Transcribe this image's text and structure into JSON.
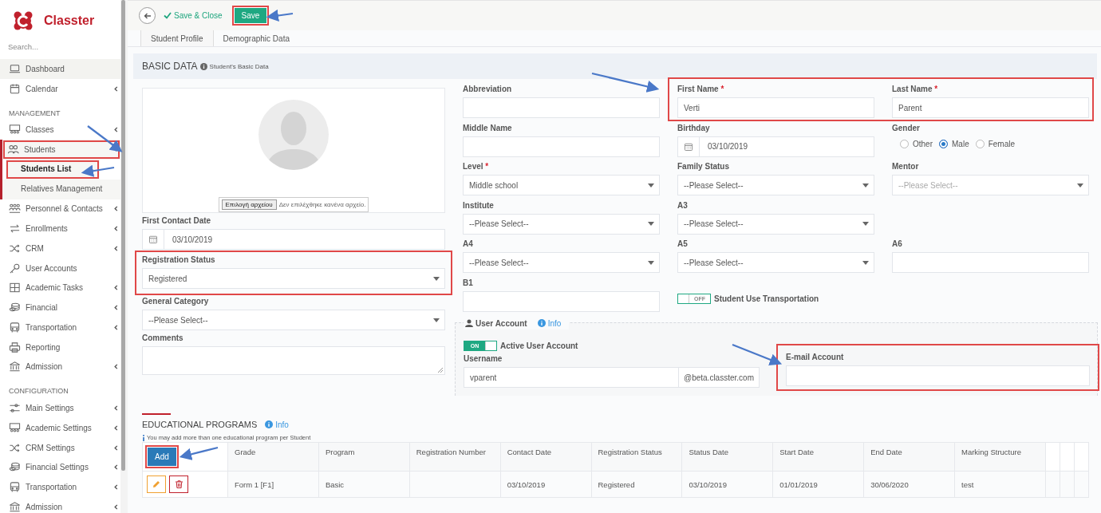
{
  "sidebar": {
    "logo": "Classter",
    "search": {
      "placeholder": "Search..."
    },
    "items": [
      {
        "kind": "link",
        "label": "Dashboard",
        "selected": true,
        "highlighted": false,
        "submenu": false
      },
      {
        "kind": "link",
        "label": "Calendar",
        "selected": false,
        "highlighted": false,
        "submenu": true,
        "expanded": false
      },
      {
        "kind": "header",
        "label": "MANAGEMENT"
      },
      {
        "kind": "link",
        "label": "Classes",
        "selected": false,
        "highlighted": false,
        "submenu": true,
        "expanded": false
      },
      {
        "kind": "link",
        "label": "Students",
        "selected": false,
        "highlighted": true,
        "submenu": true,
        "expanded": true,
        "children": [
          {
            "label": "Students List",
            "selected": true,
            "highlighted": true
          },
          {
            "label": "Relatives Management",
            "selected": false,
            "highlighted": false
          }
        ]
      },
      {
        "kind": "link",
        "label": "Personnel & Contacts",
        "selected": false,
        "highlighted": false,
        "submenu": true,
        "expanded": false
      },
      {
        "kind": "link",
        "label": "Enrollments",
        "selected": false,
        "highlighted": false,
        "submenu": true,
        "expanded": false
      },
      {
        "kind": "link",
        "label": "CRM",
        "selected": false,
        "highlighted": false,
        "submenu": true,
        "expanded": false
      },
      {
        "kind": "link",
        "label": "User Accounts",
        "selected": false,
        "highlighted": false,
        "submenu": false
      },
      {
        "kind": "link",
        "label": "Academic Tasks",
        "selected": false,
        "highlighted": false,
        "submenu": true,
        "expanded": false
      },
      {
        "kind": "link",
        "label": "Financial",
        "selected": false,
        "highlighted": false,
        "submenu": true,
        "expanded": false
      },
      {
        "kind": "link",
        "label": "Transportation",
        "selected": false,
        "highlighted": false,
        "submenu": true,
        "expanded": false
      },
      {
        "kind": "link",
        "label": "Reporting",
        "selected": false,
        "highlighted": false,
        "submenu": false
      },
      {
        "kind": "link",
        "label": "Admission",
        "selected": false,
        "highlighted": false,
        "submenu": true,
        "expanded": false
      },
      {
        "kind": "header",
        "label": "CONFIGURATION"
      },
      {
        "kind": "link",
        "label": "Main Settings",
        "selected": false,
        "highlighted": false,
        "submenu": true,
        "expanded": false
      },
      {
        "kind": "link",
        "label": "Academic Settings",
        "selected": false,
        "highlighted": false,
        "submenu": true,
        "expanded": false
      },
      {
        "kind": "link",
        "label": "CRM Settings",
        "selected": false,
        "highlighted": false,
        "submenu": true,
        "expanded": false
      },
      {
        "kind": "link",
        "label": "Financial Settings",
        "selected": false,
        "highlighted": false,
        "submenu": true,
        "expanded": false
      },
      {
        "kind": "link",
        "label": "Transportation",
        "selected": false,
        "highlighted": false,
        "submenu": true,
        "expanded": false
      },
      {
        "kind": "link",
        "label": "Admission",
        "selected": false,
        "highlighted": false,
        "submenu": true,
        "expanded": false
      }
    ]
  },
  "toolbar": {
    "save_close": "Save & Close",
    "save": {
      "label": "Save",
      "highlighted": true
    }
  },
  "tabs": [
    {
      "label": "Student Profile",
      "selected": true
    },
    {
      "label": "Demographic Data",
      "selected": false
    }
  ],
  "basic_data": {
    "title": "BASIC DATA",
    "subtitle": "Student's Basic Data"
  },
  "photo": {
    "file_button": "Επιλογή αρχείου",
    "file_status": "Δεν επιλέχθηκε κανένα αρχείο."
  },
  "left_fields": [
    {
      "kind": "date",
      "label": "First Contact Date",
      "value": "03/10/2019",
      "highlighted": false
    },
    {
      "kind": "select",
      "label": "Registration Status",
      "value": "Registered",
      "highlighted": true
    },
    {
      "kind": "select",
      "label": "General Category",
      "value": "--Please Select--",
      "highlighted": false
    },
    {
      "kind": "textarea",
      "label": "Comments",
      "highlighted": false
    }
  ],
  "grid_rows": [
    [
      {
        "kind": "text",
        "label": "Abbreviation"
      },
      {
        "kind": "group",
        "highlighted": true,
        "fields": [
          {
            "kind": "text",
            "label": "First Name",
            "required_mark": "*",
            "value": "Verti"
          },
          {
            "kind": "text",
            "label": "Last Name",
            "required_mark": "*",
            "value": "Parent"
          }
        ]
      }
    ],
    [
      {
        "kind": "text",
        "label": "Middle Name"
      },
      {
        "kind": "date",
        "label": "Birthday",
        "value": "03/10/2019"
      },
      {
        "kind": "radio",
        "label": "Gender",
        "options": [
          {
            "label": "Other",
            "selected": false
          },
          {
            "label": "Male",
            "selected": true
          },
          {
            "label": "Female",
            "selected": false
          }
        ]
      }
    ],
    [
      {
        "kind": "select",
        "label": "Level",
        "required_mark": "*",
        "value": "Middle school",
        "disabled": false
      },
      {
        "kind": "select",
        "label": "Family Status",
        "value": "--Please Select--",
        "disabled": false
      },
      {
        "kind": "select",
        "label": "Mentor",
        "value": "--Please Select--",
        "disabled": true
      }
    ],
    [
      {
        "kind": "select",
        "label": "Institute",
        "value": "--Please Select--",
        "disabled": false
      },
      {
        "kind": "select",
        "label": "A3",
        "value": "--Please Select--",
        "disabled": false
      },
      {
        "kind": "blank"
      }
    ],
    [
      {
        "kind": "select",
        "label": "A4",
        "value": "--Please Select--",
        "disabled": false
      },
      {
        "kind": "select",
        "label": "A5",
        "value": "--Please Select--",
        "disabled": false
      },
      {
        "kind": "text",
        "label": "A6"
      }
    ],
    [
      {
        "kind": "text",
        "label": "B1"
      },
      {
        "kind": "toggle",
        "label": "Student Use Transportation",
        "on": false,
        "state_text": "OFF"
      },
      {
        "kind": "blank"
      }
    ]
  ],
  "user_account": {
    "title": "User Account",
    "info": "Info",
    "active": {
      "label": "Active User Account",
      "on": true,
      "state_text": "ON"
    },
    "username": {
      "label": "Username",
      "value": "vparent",
      "suffix": "@beta.classter.com"
    },
    "email": {
      "label": "E-mail Account",
      "highlighted": true
    }
  },
  "programs": {
    "title": "EDUCATIONAL PROGRAMS",
    "info": "Info",
    "note": "You may add more than one educational program per Student",
    "add_button": {
      "label": "Add",
      "highlighted": true
    },
    "columns": [
      "Grade",
      "Program",
      "Registration Number",
      "Contact Date",
      "Registration Status",
      "Status Date",
      "Start Date",
      "End Date",
      "Marking Structure"
    ],
    "rows": [
      {
        "cells": [
          "Form 1 [F1]",
          "Basic",
          null,
          "03/10/2019",
          "Registered",
          "03/10/2019",
          "01/01/2019",
          "30/06/2020",
          "test"
        ]
      }
    ]
  }
}
